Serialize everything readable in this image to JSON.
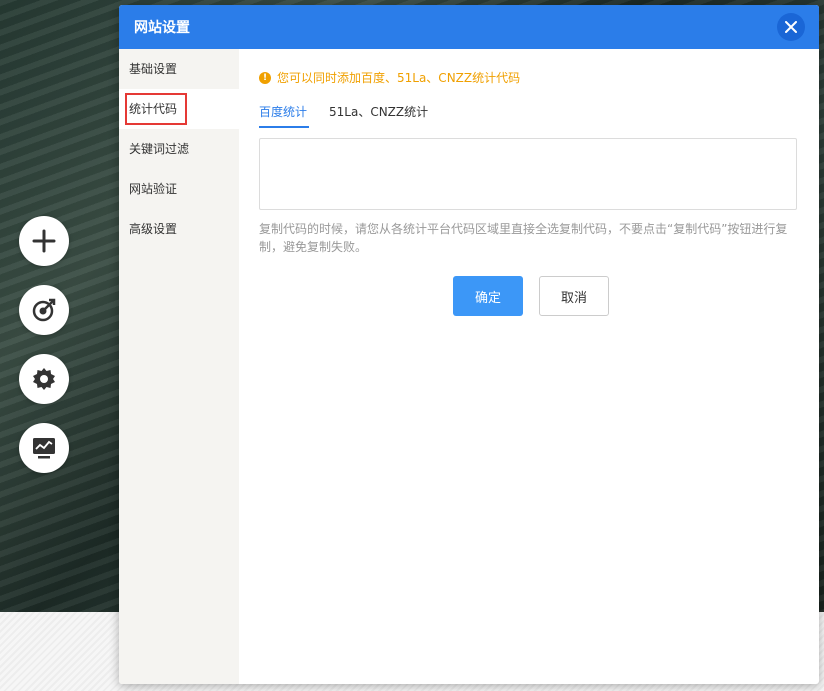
{
  "dialog": {
    "title": "网站设置"
  },
  "sidebar": {
    "items": [
      {
        "label": "基础设置"
      },
      {
        "label": "统计代码"
      },
      {
        "label": "关键词过滤"
      },
      {
        "label": "网站验证"
      },
      {
        "label": "高级设置"
      }
    ]
  },
  "content": {
    "notice": "您可以同时添加百度、51La、CNZZ统计代码",
    "tabs": [
      {
        "label": "百度统计"
      },
      {
        "label": "51La、CNZZ统计"
      }
    ],
    "code_value": "",
    "hint": "复制代码的时候，请您从各统计平台代码区域里直接全选复制代码，不要点击“复制代码”按钮进行复制，避免复制失败。",
    "confirm_label": "确定",
    "cancel_label": "取消"
  },
  "floating_buttons": [
    {
      "icon": "plus-icon"
    },
    {
      "icon": "target-icon"
    },
    {
      "icon": "gear-icon"
    },
    {
      "icon": "monitor-chart-icon"
    }
  ],
  "colors": {
    "header": "#2b7de9",
    "accent": "#2b7de9",
    "notice": "#f0a000",
    "highlight_border": "#e53935"
  }
}
